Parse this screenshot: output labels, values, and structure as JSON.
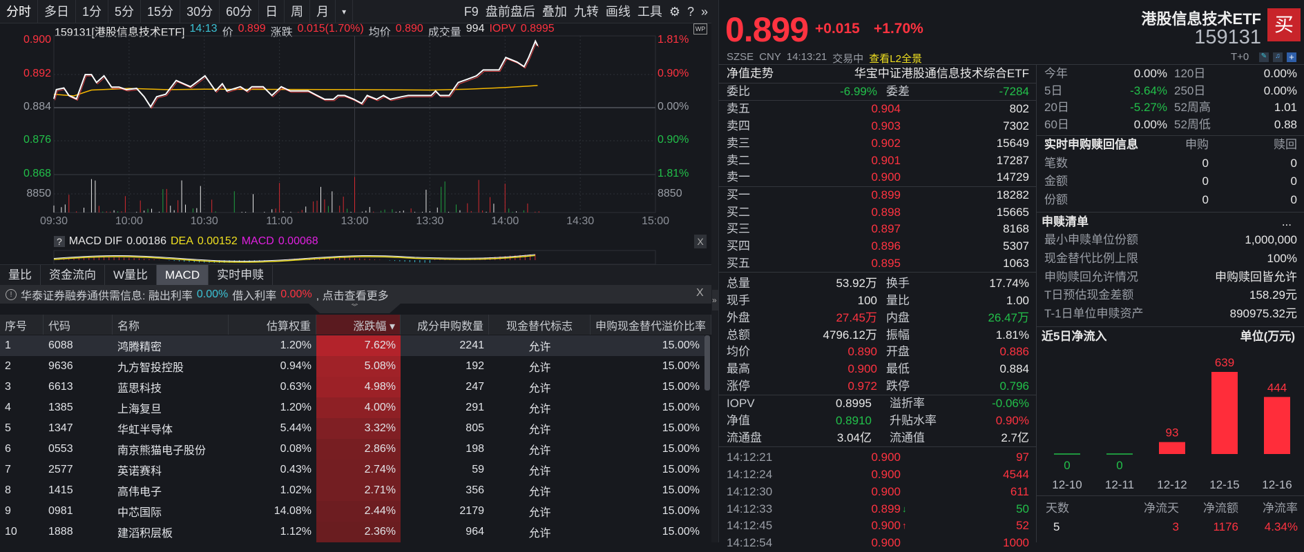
{
  "toolbar": {
    "periods": [
      "分时",
      "多日",
      "1分",
      "5分",
      "15分",
      "30分",
      "60分",
      "日",
      "周",
      "月"
    ],
    "more": "▾",
    "tools": [
      "F9",
      "盘前盘后",
      "叠加",
      "九转",
      "画线",
      "工具"
    ],
    "gear": "⚙",
    "help": "?",
    "expand": "»"
  },
  "chart_header": {
    "code_name": "159131[港股信息技术ETF]",
    "time": "14:13",
    "price_label": "价",
    "price": "0.899",
    "change_label": "涨跌",
    "change": "0.015(1.70%)",
    "avg_label": "均价",
    "avg": "0.890",
    "volume_label": "成交量",
    "volume": "994",
    "iopv_label": "IOPV",
    "iopv": "0.8995",
    "wp": "WP"
  },
  "chart_data": {
    "type": "line",
    "title": "159131 分时",
    "y_ticks_left": [
      "0.900",
      "0.892",
      "0.884",
      "0.876",
      "0.868"
    ],
    "y_ticks_right": [
      "1.81%",
      "0.90%",
      "0.00%",
      "0.90%",
      "1.81%"
    ],
    "ylim": [
      0.868,
      0.9
    ],
    "prev_close": 0.884,
    "volume_tick": "8850",
    "x_ticks": [
      "09:30",
      "10:00",
      "10:30",
      "11:00",
      "13:00",
      "13:30",
      "14:00",
      "14:30",
      "15:00"
    ],
    "x_minutes_total": 240,
    "price_series": [
      [
        0,
        0.8861
      ],
      [
        1,
        0.8883
      ],
      [
        4,
        0.8887
      ],
      [
        6,
        0.8869
      ],
      [
        9,
        0.8861
      ],
      [
        12.5,
        0.8919
      ],
      [
        15,
        0.8919
      ],
      [
        17,
        0.89
      ],
      [
        20,
        0.8916
      ],
      [
        23,
        0.8889
      ],
      [
        26,
        0.8889
      ],
      [
        29,
        0.8883
      ],
      [
        33,
        0.8886
      ],
      [
        36,
        0.8866
      ],
      [
        38.6,
        0.8842
      ],
      [
        41,
        0.8866
      ],
      [
        44.6,
        0.8872
      ],
      [
        48.8,
        0.8905
      ],
      [
        54.5,
        0.889
      ],
      [
        60.3,
        0.8916
      ],
      [
        64.5,
        0.888
      ],
      [
        67.2,
        0.8897
      ],
      [
        69,
        0.888
      ],
      [
        74.4,
        0.889
      ],
      [
        77,
        0.888
      ],
      [
        79,
        0.889
      ],
      [
        83.5,
        0.889
      ],
      [
        87,
        0.8869
      ],
      [
        90.7,
        0.889
      ],
      [
        94.3,
        0.888
      ],
      [
        101.5,
        0.888
      ],
      [
        105,
        0.8869
      ],
      [
        108,
        0.886
      ],
      [
        111.5,
        0.886
      ],
      [
        113.3,
        0.8869
      ],
      [
        116,
        0.8869
      ],
      [
        119.7,
        0.886
      ],
      [
        122.8,
        0.885
      ],
      [
        125,
        0.8869
      ],
      [
        128.8,
        0.886
      ],
      [
        131.5,
        0.8869
      ],
      [
        134.2,
        0.886
      ],
      [
        138.7,
        0.8866
      ],
      [
        141.4,
        0.8869
      ],
      [
        150.5,
        0.8869
      ],
      [
        152.3,
        0.888
      ],
      [
        154,
        0.8869
      ],
      [
        157.7,
        0.8869
      ],
      [
        161.3,
        0.89
      ],
      [
        165,
        0.8908
      ],
      [
        168.6,
        0.8916
      ],
      [
        171.3,
        0.893
      ],
      [
        177.6,
        0.893
      ],
      [
        180.3,
        0.896
      ],
      [
        184.8,
        0.8949
      ],
      [
        187.6,
        0.8938
      ],
      [
        189.4,
        0.896
      ],
      [
        192.1,
        0.8999
      ],
      [
        193,
        0.8988
      ]
    ],
    "avg_series": [
      [
        0,
        0.8872
      ],
      [
        8,
        0.8868
      ],
      [
        15,
        0.8882
      ],
      [
        30,
        0.8886
      ],
      [
        45,
        0.8883
      ],
      [
        60,
        0.8884
      ],
      [
        120,
        0.8883
      ],
      [
        150,
        0.8882
      ],
      [
        165,
        0.8884
      ],
      [
        180,
        0.8888
      ],
      [
        193,
        0.8893
      ]
    ],
    "macd": {
      "dif_label": "MACD DIF",
      "dif": "0.00186",
      "dea_label": "DEA",
      "dea": "0.00152",
      "macd_label": "MACD",
      "macd": "0.00068",
      "help": "?",
      "close": "X"
    }
  },
  "tabs": [
    "量比",
    "资金流向",
    "W量比",
    "MACD",
    "实时申赎"
  ],
  "notice": {
    "icon": "!",
    "text": "华泰证券融券通供需信息: 融出利率",
    "lend_rate": "0.00%",
    "borrow_label": "借入利率",
    "borrow_rate": "0.00%",
    "more": ", 点击查看更多",
    "close": "X"
  },
  "table": {
    "headers": [
      "序号",
      "代码",
      "名称",
      "估算权重",
      "涨跌幅 ▾",
      "成分申购数量",
      "现金替代标志",
      "申购现金替代溢价比率"
    ],
    "rows": [
      [
        "1",
        "6088",
        "鸿腾精密",
        "1.20%",
        "7.62%",
        "2241",
        "允许",
        "15.00%"
      ],
      [
        "2",
        "9636",
        "九方智投控股",
        "0.94%",
        "5.08%",
        "192",
        "允许",
        "15.00%"
      ],
      [
        "3",
        "6613",
        "蓝思科技",
        "0.63%",
        "4.98%",
        "247",
        "允许",
        "15.00%"
      ],
      [
        "4",
        "1385",
        "上海复旦",
        "1.20%",
        "4.00%",
        "291",
        "允许",
        "15.00%"
      ],
      [
        "5",
        "1347",
        "华虹半导体",
        "5.44%",
        "3.32%",
        "805",
        "允许",
        "15.00%"
      ],
      [
        "6",
        "0553",
        "南京熊猫电子股份",
        "0.08%",
        "2.86%",
        "198",
        "允许",
        "15.00%"
      ],
      [
        "7",
        "2577",
        "英诺赛科",
        "0.43%",
        "2.74%",
        "59",
        "允许",
        "15.00%"
      ],
      [
        "8",
        "1415",
        "高伟电子",
        "1.02%",
        "2.71%",
        "356",
        "允许",
        "15.00%"
      ],
      [
        "9",
        "0981",
        "中芯国际",
        "14.08%",
        "2.44%",
        "2179",
        "允许",
        "15.00%"
      ],
      [
        "10",
        "1888",
        "建滔积层板",
        "1.12%",
        "2.36%",
        "964",
        "允许",
        "15.00%"
      ]
    ]
  },
  "quote": {
    "price": "0.899",
    "change": "+0.015",
    "pct": "+1.70%",
    "name": "港股信息技术ETF",
    "code": "159131",
    "buy": "买",
    "exchange": "SZSE",
    "currency": "CNY",
    "time": "14:13:21",
    "status": "交易中",
    "l2": "查看L2全景",
    "t0": "T+0"
  },
  "nav_row": {
    "label": "净值走势",
    "value": "华宝中证港股通信息技术综合ETF"
  },
  "weibi": {
    "label": "委比",
    "value": "-6.99%",
    "label2": "委差",
    "value2": "-7284"
  },
  "asks": [
    [
      "卖五",
      "0.904",
      "802"
    ],
    [
      "卖四",
      "0.903",
      "7302"
    ],
    [
      "卖三",
      "0.902",
      "15649"
    ],
    [
      "卖二",
      "0.901",
      "17287"
    ],
    [
      "卖一",
      "0.900",
      "14729"
    ]
  ],
  "bids": [
    [
      "买一",
      "0.899",
      "18282"
    ],
    [
      "买二",
      "0.898",
      "15665"
    ],
    [
      "买三",
      "0.897",
      "8168"
    ],
    [
      "买四",
      "0.896",
      "5307"
    ],
    [
      "买五",
      "0.895",
      "1063"
    ]
  ],
  "stats": [
    [
      "总量",
      "53.92万",
      "换手",
      "17.74%"
    ],
    [
      "现手",
      "100",
      "量比",
      "1.00"
    ],
    [
      "外盘",
      "27.45万",
      "内盘",
      "26.47万"
    ],
    [
      "总额",
      "4796.12万",
      "振幅",
      "1.81%"
    ],
    [
      "均价",
      "0.890",
      "开盘",
      "0.886"
    ],
    [
      "最高",
      "0.900",
      "最低",
      "0.884"
    ],
    [
      "涨停",
      "0.972",
      "跌停",
      "0.796"
    ]
  ],
  "etf_stats": [
    [
      "IOPV",
      "0.8995",
      "溢折率",
      "-0.06%"
    ],
    [
      "净值",
      "0.8910",
      "升贴水率",
      "0.90%"
    ],
    [
      "流通盘",
      "3.04亿",
      "流通值",
      "2.7亿"
    ]
  ],
  "trades": [
    [
      "14:12:21",
      "0.900",
      "",
      "97"
    ],
    [
      "14:12:24",
      "0.900",
      "",
      "4544"
    ],
    [
      "14:12:30",
      "0.900",
      "",
      "611"
    ],
    [
      "14:12:33",
      "0.899",
      "down",
      "50"
    ],
    [
      "14:12:45",
      "0.900",
      "up",
      "52"
    ],
    [
      "14:12:54",
      "0.900",
      "",
      "1000"
    ]
  ],
  "returns": [
    [
      "今年",
      "0.00%",
      "120日",
      "0.00%"
    ],
    [
      "5日",
      "-3.64%",
      "250日",
      "0.00%"
    ],
    [
      "20日",
      "-5.27%",
      "52周高",
      "1.01"
    ],
    [
      "60日",
      "0.00%",
      "52周低",
      "0.88"
    ]
  ],
  "realtime": {
    "title": "实时申购赎回信息",
    "col1": "申购",
    "col2": "赎回",
    "rows": [
      [
        "笔数",
        "0",
        "0"
      ],
      [
        "金额",
        "0",
        "0"
      ],
      [
        "份额",
        "0",
        "0"
      ]
    ]
  },
  "creation": {
    "title": "申赎清单",
    "more": "...",
    "rows": [
      [
        "最小申赎单位份额",
        "1,000,000"
      ],
      [
        "现金替代比例上限",
        "100%"
      ],
      [
        "申购赎回允许情况",
        "申购赎回皆允许"
      ],
      [
        "T日预估现金差额",
        "158.29元"
      ],
      [
        "T-1日单位申赎资产",
        "890975.32元"
      ]
    ]
  },
  "inflow": {
    "title": "近5日净流入",
    "unit": "单位(万元)",
    "dates": [
      "12-10",
      "12-11",
      "12-12",
      "12-15",
      "12-16"
    ],
    "values": [
      0,
      0,
      93,
      639,
      444
    ],
    "summary_headers": [
      "天数",
      "净流天",
      "净流额",
      "净流率"
    ],
    "summary_rows": [
      [
        "5",
        "3",
        "1176",
        "4.34%"
      ]
    ]
  },
  "colors": {
    "up": "#ff3340",
    "down": "#22c04a",
    "avg": "#f5b800",
    "bg": "#17191e"
  }
}
